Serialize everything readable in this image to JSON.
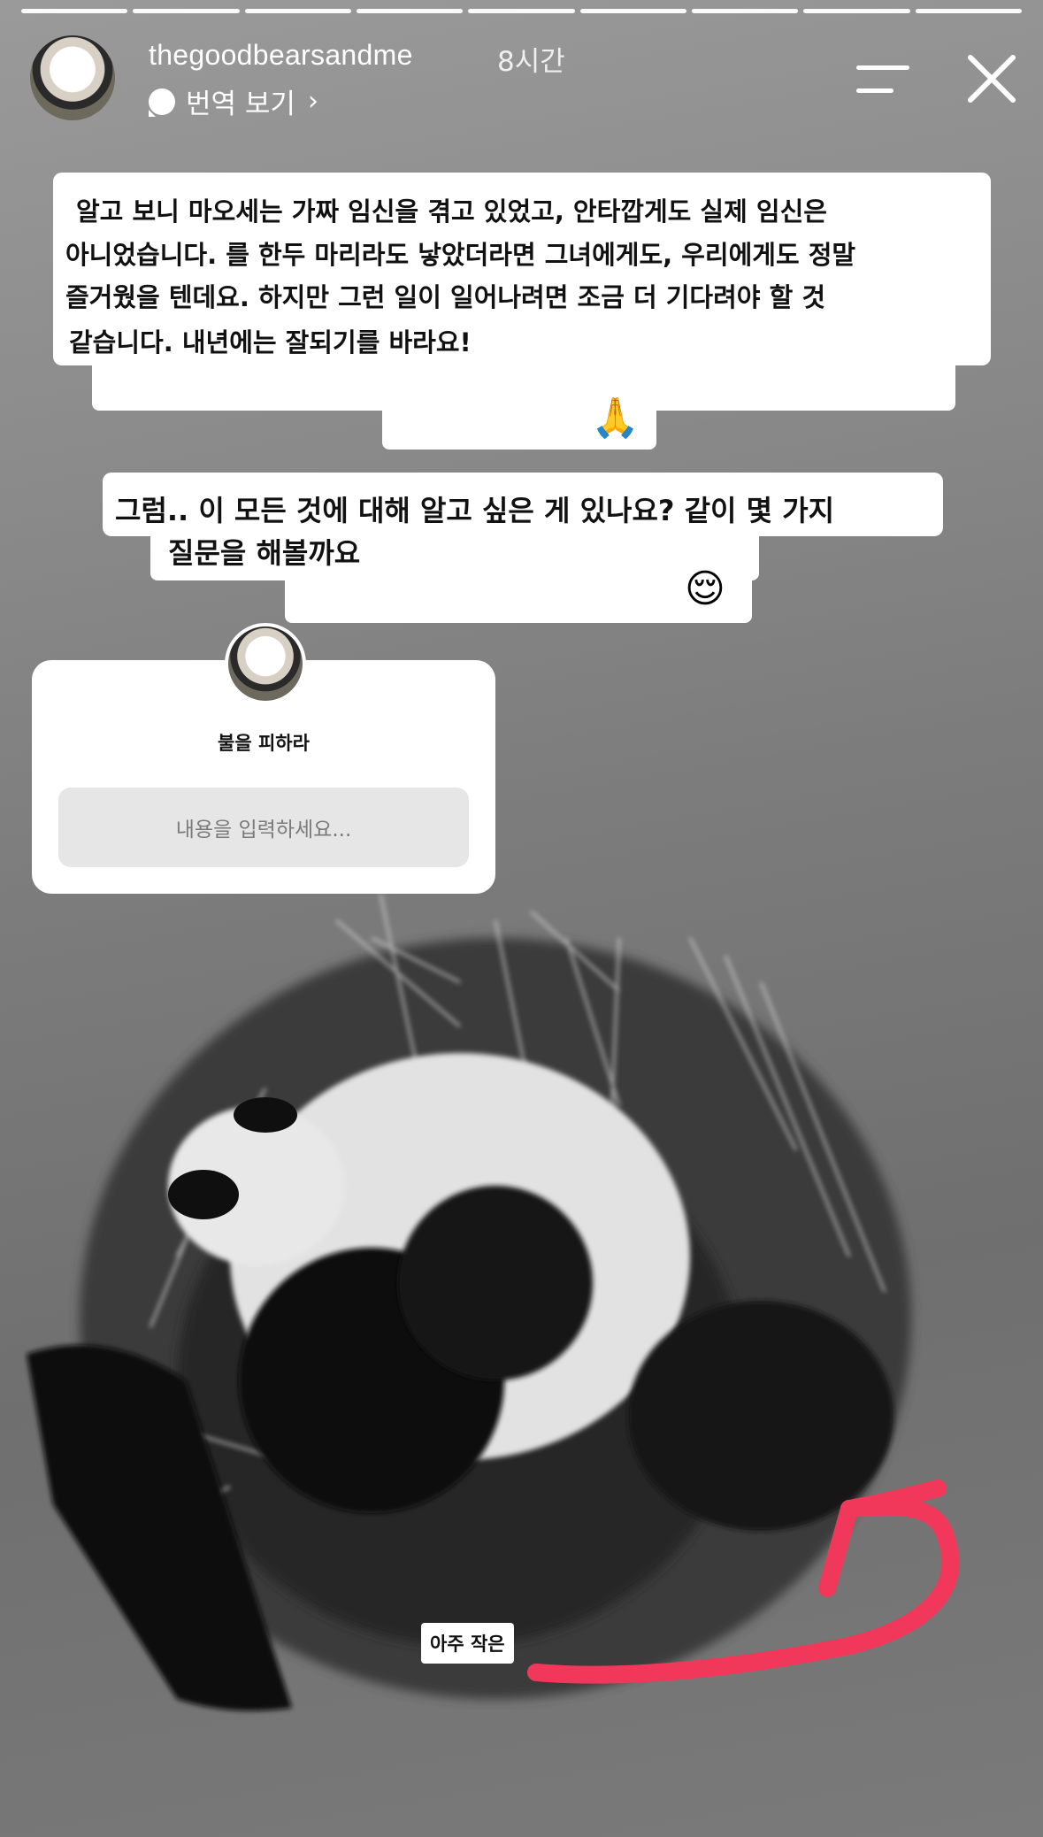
{
  "header": {
    "username": "thegoodbearsandme",
    "timestamp": "8시간",
    "translate_label": "번역 보기",
    "progress_segments": 9,
    "progress_done": 9
  },
  "caption": {
    "block1_lines": [
      "알고 보니 마오세는 가짜 임신을 겪고 있었고, 안타깝게도 실제 임신은",
      "아니었습니다. 를 한두 마리라도 낳았더라면 그녀에게도, 우리에게도 정말",
      "즐거웠을 텐데요. 하지만 그런 일이 일어나려면 조금 더 기다려야 할 것",
      "같습니다. 내년에는 잘되기를 바라요!"
    ],
    "block1_emoji": "🙏",
    "block2_lines": [
      "그럼.. 이 모든 것에 대해 알고 싶은 게 있나요? 같이 몇 가지",
      "질문을 해볼까요"
    ],
    "block2_emoji": "😌"
  },
  "question_sticker": {
    "prompt": "불을 피하라",
    "placeholder": "내용을 입력하세요..."
  },
  "annotation": {
    "label": "아주 작은",
    "arrow_color": "#f2385a"
  },
  "colors": {
    "text_dark": "#111111",
    "sticker_bg": "#ffffff",
    "input_bg": "#e6e6e6"
  }
}
